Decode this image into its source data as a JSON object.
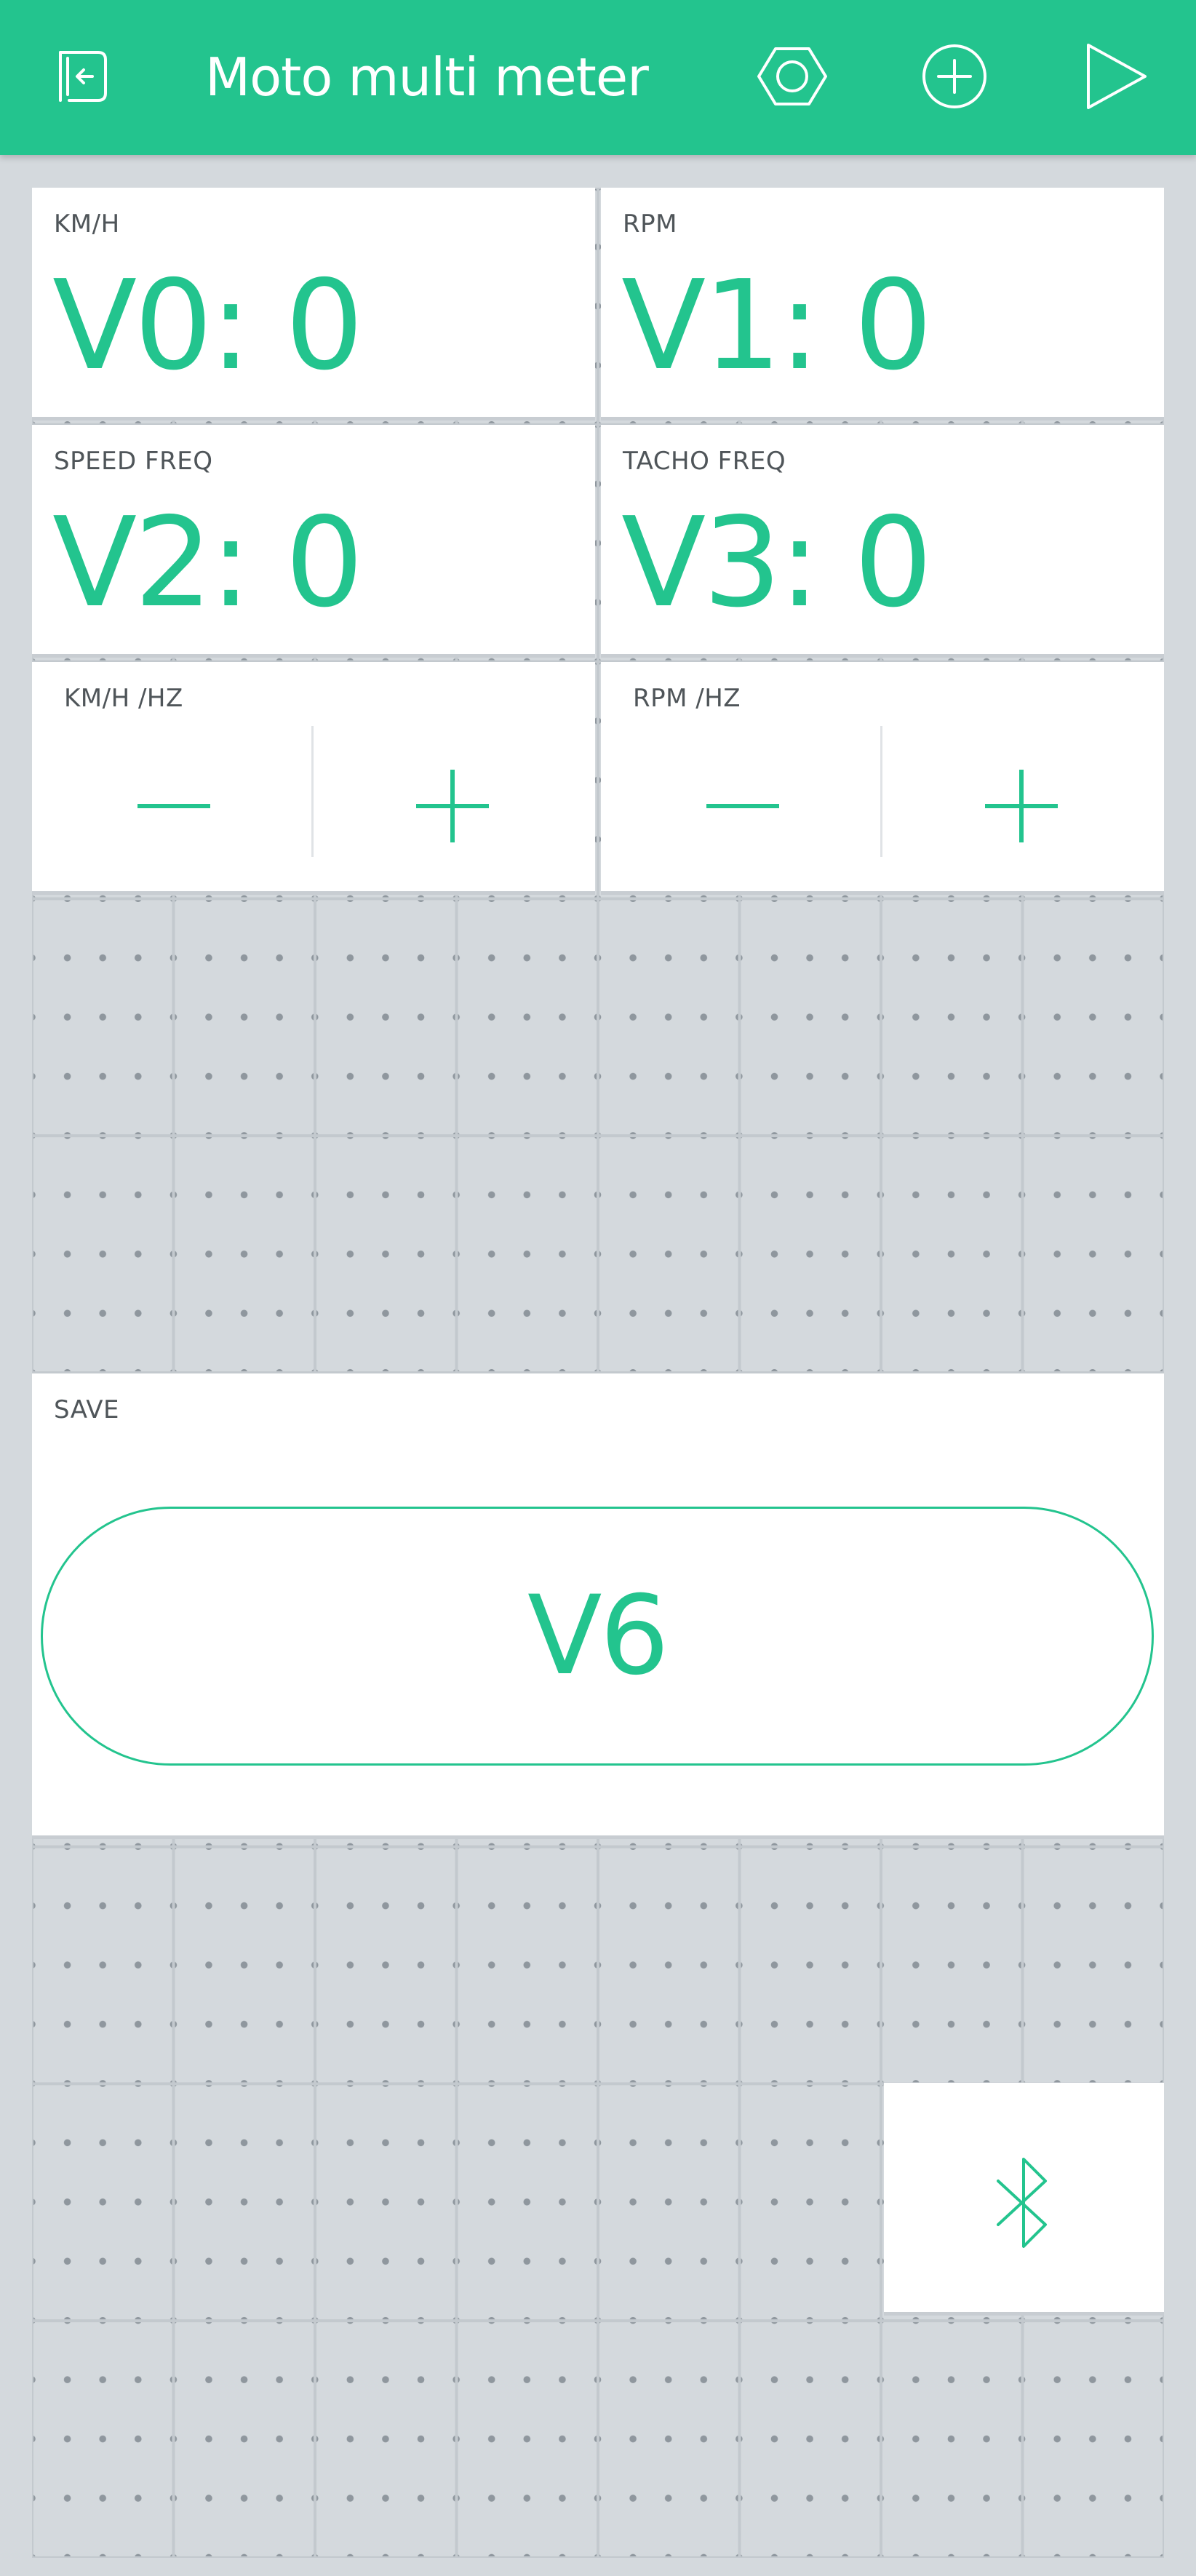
{
  "app": {
    "title": "Moto multi meter",
    "accent_color": "#23c48e",
    "icons": {
      "back": "exit-project-icon",
      "settings": "hexagon-settings-icon",
      "add": "add-widget-icon",
      "play": "play-icon"
    }
  },
  "widgets": {
    "kmh": {
      "label": "KM/H",
      "value": "V0: 0"
    },
    "rpm": {
      "label": "RPM",
      "value": "V1: 0"
    },
    "speed_freq": {
      "label": "SPEED FREQ",
      "value": "V2: 0"
    },
    "tacho_freq": {
      "label": "TACHO FREQ",
      "value": "V3: 0"
    },
    "kmh_hz": {
      "label": "KM/H /HZ",
      "minus_icon": "minus-icon",
      "plus_icon": "plus-icon"
    },
    "rpm_hz": {
      "label": "RPM /HZ",
      "minus_icon": "minus-icon",
      "plus_icon": "plus-icon"
    },
    "save": {
      "label": "SAVE",
      "button_text": "V6"
    },
    "bluetooth": {
      "icon": "bluetooth-icon"
    }
  }
}
